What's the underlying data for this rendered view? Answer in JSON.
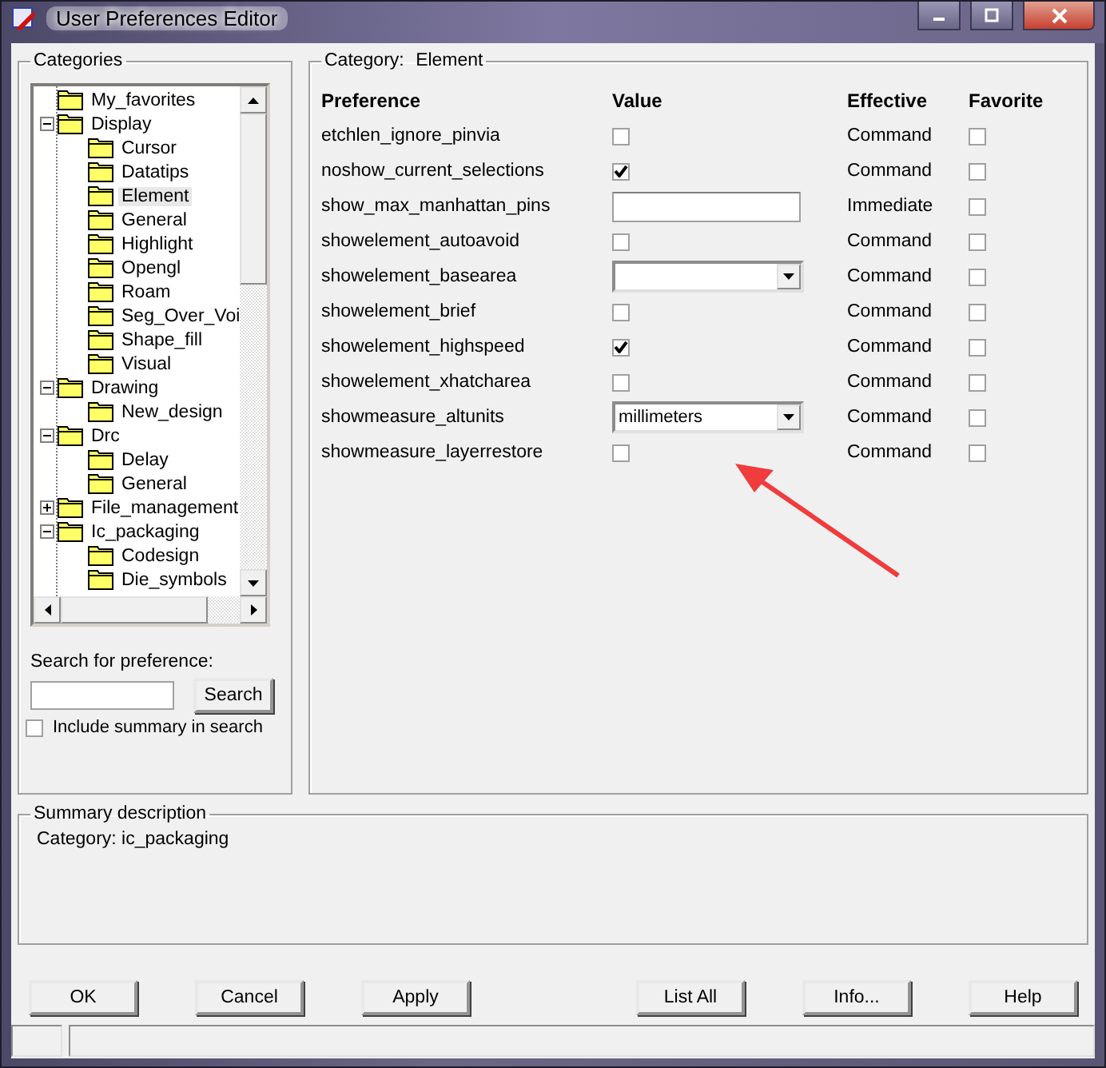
{
  "window": {
    "title": "User Preferences Editor"
  },
  "categories": {
    "title": "Categories",
    "tree": [
      {
        "label": "My_favorites",
        "selected": false
      },
      {
        "label": "Display",
        "selected": false,
        "expanded": true,
        "children": [
          {
            "label": "Cursor",
            "selected": false
          },
          {
            "label": "Datatips",
            "selected": false
          },
          {
            "label": "Element",
            "selected": true
          },
          {
            "label": "General",
            "selected": false
          },
          {
            "label": "Highlight",
            "selected": false
          },
          {
            "label": "Opengl",
            "selected": false
          },
          {
            "label": "Roam",
            "selected": false
          },
          {
            "label": "Seg_Over_Voi",
            "selected": false
          },
          {
            "label": "Shape_fill",
            "selected": false
          },
          {
            "label": "Visual",
            "selected": false
          }
        ]
      },
      {
        "label": "Drawing",
        "selected": false,
        "expanded": true,
        "children": [
          {
            "label": "New_design",
            "selected": false
          }
        ]
      },
      {
        "label": "Drc",
        "selected": false,
        "expanded": true,
        "children": [
          {
            "label": "Delay",
            "selected": false
          },
          {
            "label": "General",
            "selected": false
          }
        ]
      },
      {
        "label": "File_management",
        "selected": false,
        "expanded": false
      },
      {
        "label": "Ic_packaging",
        "selected": false,
        "expanded": true,
        "children": [
          {
            "label": "Codesign",
            "selected": false
          },
          {
            "label": "Die_symbols",
            "selected": false
          }
        ]
      }
    ],
    "search_label": "Search for preference:",
    "search_button": "Search",
    "include_summary": {
      "label": "Include summary in search",
      "checked": false
    }
  },
  "preferences": {
    "category_label": "Category:",
    "category_value": "Element",
    "columns": [
      "Preference",
      "Value",
      "Effective",
      "Favorite"
    ],
    "rows": [
      {
        "name": "etchlen_ignore_pinvia",
        "kind": "checkbox",
        "checked": false,
        "effective": "Command",
        "favorite": false
      },
      {
        "name": "noshow_current_selections",
        "kind": "checkbox",
        "checked": true,
        "effective": "Command",
        "favorite": false
      },
      {
        "name": "show_max_manhattan_pins",
        "kind": "text",
        "effective": "Immediate",
        "favorite": false
      },
      {
        "name": "showelement_autoavoid",
        "kind": "checkbox",
        "checked": false,
        "effective": "Command",
        "favorite": false
      },
      {
        "name": "showelement_basearea",
        "kind": "dropdown",
        "effective": "Command",
        "favorite": false
      },
      {
        "name": "showelement_brief",
        "kind": "checkbox",
        "checked": false,
        "effective": "Command",
        "favorite": false
      },
      {
        "name": "showelement_highspeed",
        "kind": "checkbox",
        "checked": true,
        "effective": "Command",
        "favorite": false
      },
      {
        "name": "showelement_xhatcharea",
        "kind": "checkbox",
        "checked": false,
        "effective": "Command",
        "favorite": false
      },
      {
        "name": "showmeasure_altunits",
        "kind": "dropdown",
        "value": "millimeters",
        "effective": "Command",
        "favorite": false
      },
      {
        "name": "showmeasure_layerrestore",
        "kind": "checkbox",
        "checked": false,
        "effective": "Command",
        "favorite": false
      }
    ]
  },
  "summary": {
    "title": "Summary description",
    "text": "Category: ic_packaging"
  },
  "buttons": [
    "OK",
    "Cancel",
    "Apply",
    "List All",
    "Info...",
    "Help"
  ]
}
